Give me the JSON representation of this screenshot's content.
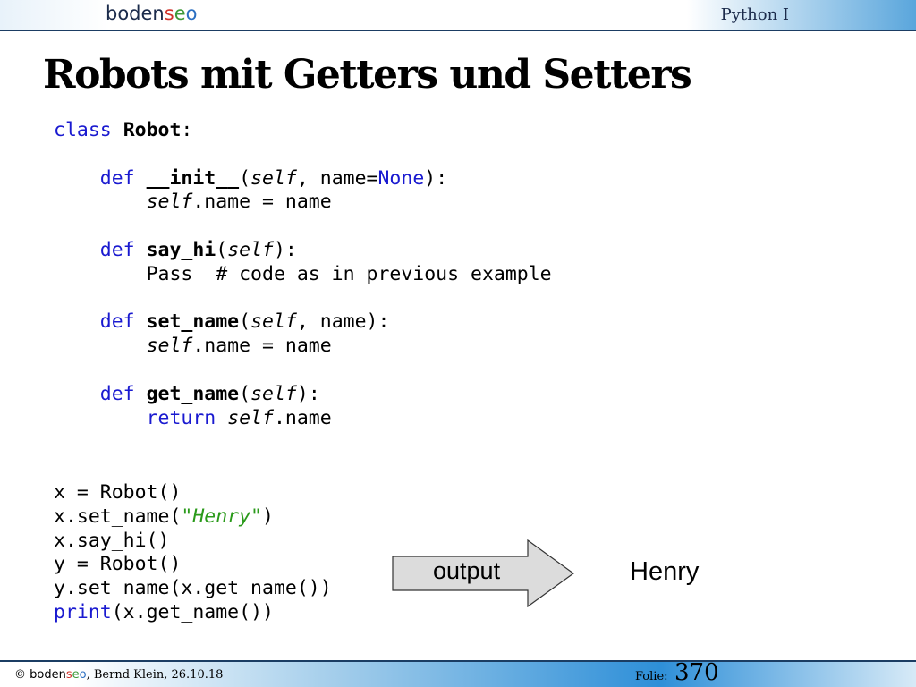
{
  "header": {
    "logo": {
      "part1": "boden",
      "part2": "s",
      "part3": "e",
      "part4": "o"
    },
    "course": "Python I"
  },
  "slide": {
    "title": "Robots mit Getters und Setters"
  },
  "code": {
    "class_kw": "class",
    "class_name": "Robot",
    "colon": ":",
    "def_kw": "def",
    "init_name": "__init__",
    "init_params_pre": "(",
    "self_kw": "self",
    "init_params_mid": ", name=",
    "none_kw": "None",
    "params_end": "):",
    "init_body_rest": ".name = name",
    "say_hi_name": "say_hi",
    "say_hi_body": "Pass  # code as in previous example",
    "set_name_name": "set_name",
    "set_name_params": ", name):",
    "set_name_body_rest": ".name = name",
    "get_name_name": "get_name",
    "return_kw": "return",
    "get_name_body_rest": ".name"
  },
  "usage": {
    "line1": "x = Robot()",
    "line2_pre": "x.set_name(",
    "line2_str": "\"Henry\"",
    "line2_post": ")",
    "line3": "x.say_hi()",
    "line4": "y = Robot()",
    "line5": "y.set_name(x.get_name())",
    "print_kw": "print",
    "line6_rest": "(x.get_name())"
  },
  "output": {
    "arrow_label": "output",
    "value": "Henry"
  },
  "footer": {
    "copyright": "©",
    "brand": {
      "part1": "boden",
      "part2": "s",
      "part3": "e",
      "part4": "o"
    },
    "author_date": ", Bernd Klein, 26.10.18",
    "folie_label": "Folie:",
    "slide_number": "370"
  },
  "colors": {
    "keyword": "#1a1ad0",
    "string": "#2a9a1a",
    "header_accent": "#5aa6dc",
    "footer_accent": "#2e8fd8",
    "arrow_fill": "#dcdcdc"
  }
}
